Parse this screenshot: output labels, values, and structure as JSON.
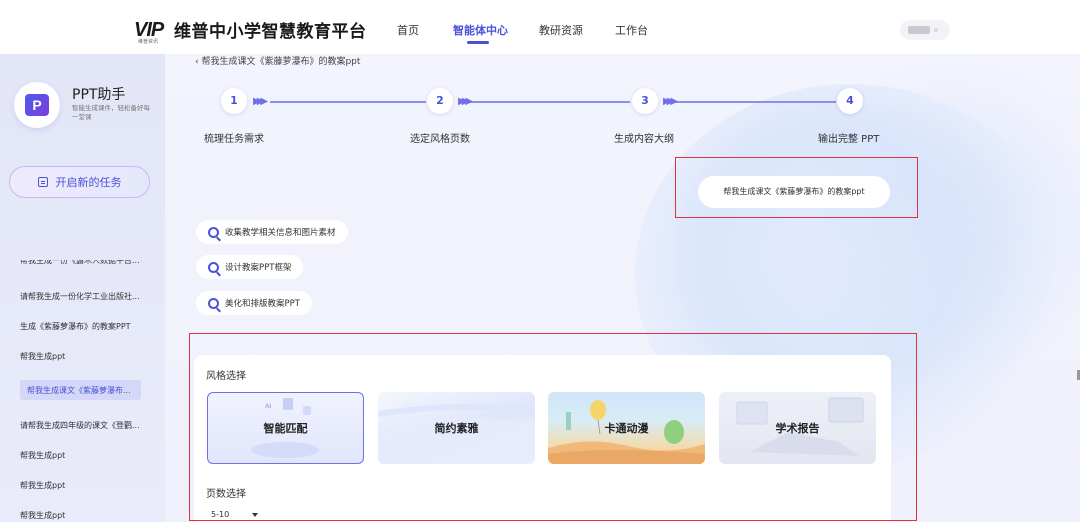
{
  "header": {
    "logo_mark": "VIP",
    "logo_sub": "维普资讯",
    "platform_name": "维普中小学智慧教育平台",
    "nav": [
      {
        "label": "首页",
        "active": false
      },
      {
        "label": "智能体中心",
        "active": true
      },
      {
        "label": "教研资源",
        "active": false
      },
      {
        "label": "工作台",
        "active": false
      }
    ]
  },
  "sidebar": {
    "app_name": "PPT助手",
    "app_icon_letter": "P",
    "app_desc": "智能生成课件，轻松备好每一堂课",
    "new_task_label": "开启新的任务",
    "history_cut": "帮我生成一份《露木人数据平台...",
    "history": [
      "请帮我生成一份化学工业出版社...",
      "生成《紫藤萝瀑布》的教案PPT",
      "帮我生成ppt",
      "帮我生成课文《紫藤萝瀑布...",
      "请帮我生成四年级的课文《登鹳...",
      "帮我生成ppt",
      "帮我生成ppt",
      "帮我生成ppt"
    ],
    "active_index": 3
  },
  "main": {
    "breadcrumb": "帮我生成课文《紫藤萝瀑布》的教案ppt",
    "steps": [
      {
        "num": "1",
        "label": "梳理任务需求"
      },
      {
        "num": "2",
        "label": "选定风格页数"
      },
      {
        "num": "3",
        "label": "生成内容大纲"
      },
      {
        "num": "4",
        "label": "输出完整 PPT"
      }
    ],
    "prompt": "帮我生成课文《紫藤萝瀑布》的教案ppt",
    "chips": [
      "收集教学相关信息和图片素材",
      "设计教案PPT框架",
      "美化和排版教案PPT"
    ],
    "style_section": {
      "title": "风格选择",
      "options": [
        {
          "label": "智能匹配",
          "selected": true
        },
        {
          "label": "简约素雅",
          "selected": false
        },
        {
          "label": "卡通动漫",
          "selected": false
        },
        {
          "label": "学术报告",
          "selected": false
        }
      ]
    },
    "page_section": {
      "title": "页数选择",
      "value": "5-10"
    }
  },
  "colors": {
    "accent": "#4a52d8",
    "highlight_box": "#e0343c",
    "sidebar_bg": "#e3e6f8"
  }
}
